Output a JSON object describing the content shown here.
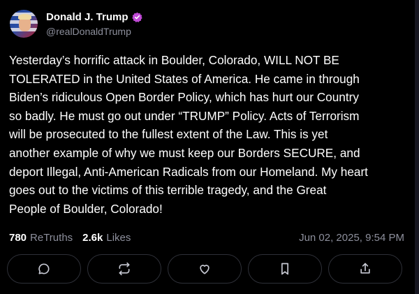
{
  "author": {
    "display_name": "Donald J. Trump",
    "handle": "@realDonaldTrump",
    "avatar_icon": "profile-photo",
    "verified_icon": "verified-badge-icon",
    "verified_color": "#c04ad6"
  },
  "post": {
    "text": "Yesterday’s horrific attack in Boulder, Colorado, WILL NOT BE\nTOLERATED in the United States of America. He came in through\nBiden’s ridiculous Open Border Policy, which has hurt our Country\nso badly. He must go out under “TRUMP” Policy. Acts of Terrorism\nwill be prosecuted to the fullest extent of the Law. This is yet\nanother example of why we must keep our Borders SECURE, and\ndeport Illegal, Anti-American Radicals from our Homeland. My heart\ngoes out to the victims of this terrible tragedy, and the Great\nPeople of Boulder, Colorado!"
  },
  "stats": {
    "retruths_count": "780",
    "retruths_label": "ReTruths",
    "likes_count": "2.6k",
    "likes_label": "Likes",
    "timestamp": "Jun 02, 2025, 9:54 PM"
  },
  "actions": [
    {
      "name": "reply",
      "icon": "comment-icon"
    },
    {
      "name": "retruth",
      "icon": "repost-icon"
    },
    {
      "name": "like",
      "icon": "heart-icon"
    },
    {
      "name": "bookmark",
      "icon": "bookmark-icon"
    },
    {
      "name": "share",
      "icon": "share-icon"
    }
  ],
  "colors": {
    "background": "#000000",
    "text": "#ffffff",
    "muted": "#8d8f9c",
    "button_border": "#2e3038"
  }
}
